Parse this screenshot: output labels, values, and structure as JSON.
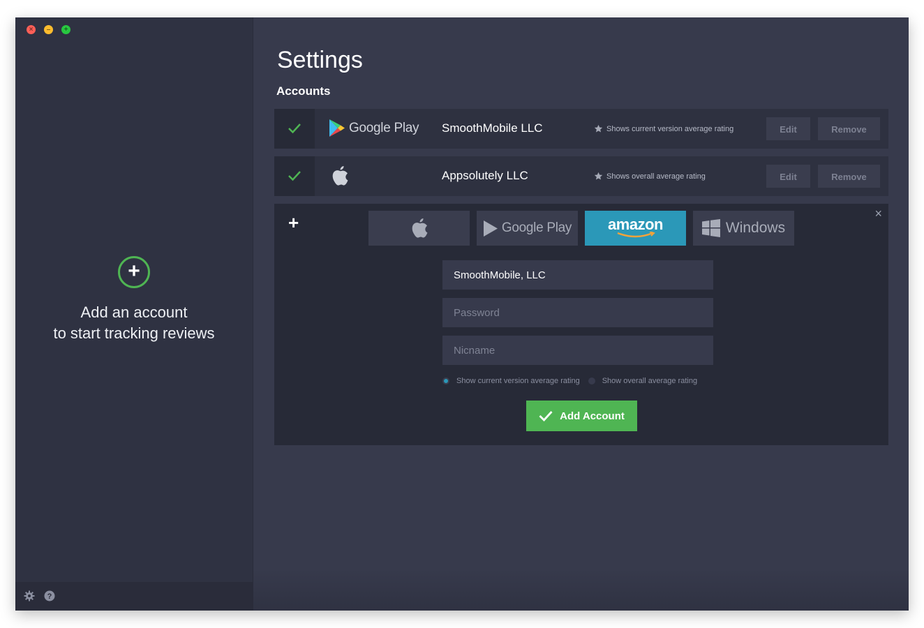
{
  "window": {
    "controls": {
      "close": "×",
      "minimize": "–",
      "maximize": "+"
    }
  },
  "sidebar": {
    "empty_state": {
      "line1": "Add an account",
      "line2": "to start tracking reviews",
      "plus": "+"
    },
    "footer": {
      "settings_icon": "gear-icon",
      "help_icon": "help-icon"
    }
  },
  "main": {
    "title": "Settings",
    "section": "Accounts",
    "accounts": [
      {
        "store": "Google Play",
        "store_icon": "google-play-logo",
        "name": "SmoothMobile LLC",
        "rating_note": "Shows current version average rating",
        "edit_label": "Edit",
        "remove_label": "Remove"
      },
      {
        "store": "App Store",
        "store_icon": "apple-icon",
        "name": "Appsolutely LLC",
        "rating_note": "Shows overall average rating",
        "edit_label": "Edit",
        "remove_label": "Remove"
      }
    ],
    "add_panel": {
      "plus": "+",
      "close": "×",
      "store_tabs": [
        {
          "id": "apple",
          "label": "",
          "icon": "apple-icon"
        },
        {
          "id": "google",
          "label": "Google Play",
          "icon": "google-play-logo"
        },
        {
          "id": "amazon",
          "label": "amazon",
          "icon": "amazon-logo",
          "selected": true
        },
        {
          "id": "windows",
          "label": "Windows",
          "icon": "windows-logo"
        }
      ],
      "username_value": "SmoothMobile, LLC",
      "password_placeholder": "Password",
      "nickname_placeholder": "Nicname",
      "radio_options": [
        {
          "label": "Show current version average rating",
          "selected": true
        },
        {
          "label": "Show overall average rating",
          "selected": false
        }
      ],
      "submit_label": "Add Account"
    }
  },
  "colors": {
    "sidebar_bg": "#2f3242",
    "main_bg": "#373a4c",
    "row_bg": "#2e3140",
    "accent_green": "#4fb553",
    "accent_blue": "#2b98b8",
    "amazon_orange": "#f3a33a"
  }
}
